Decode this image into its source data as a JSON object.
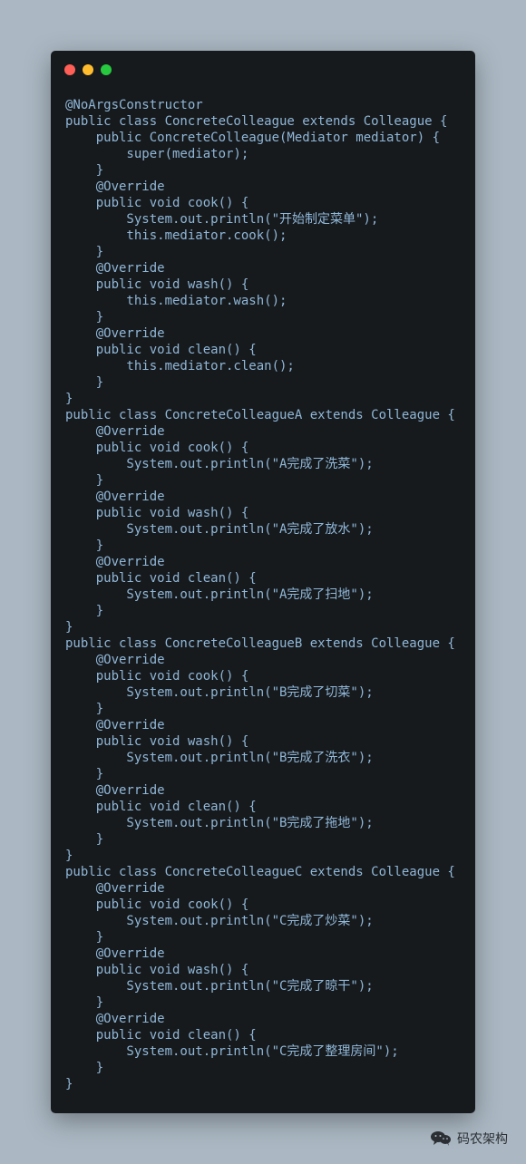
{
  "window": {
    "buttons": [
      {
        "name": "close",
        "color": "#ff5f56"
      },
      {
        "name": "minimize",
        "color": "#ffbd2e"
      },
      {
        "name": "maximize",
        "color": "#27c93f"
      }
    ]
  },
  "code": {
    "lines": [
      "@NoArgsConstructor",
      "public class ConcreteColleague extends Colleague {",
      "    public ConcreteColleague(Mediator mediator) {",
      "        super(mediator);",
      "    }",
      "    @Override",
      "    public void cook() {",
      "        System.out.println(\"开始制定菜单\");",
      "        this.mediator.cook();",
      "    }",
      "    @Override",
      "    public void wash() {",
      "        this.mediator.wash();",
      "    }",
      "    @Override",
      "    public void clean() {",
      "        this.mediator.clean();",
      "    }",
      "}",
      "public class ConcreteColleagueA extends Colleague {",
      "    @Override",
      "    public void cook() {",
      "        System.out.println(\"A完成了洗菜\");",
      "    }",
      "    @Override",
      "    public void wash() {",
      "        System.out.println(\"A完成了放水\");",
      "    }",
      "    @Override",
      "    public void clean() {",
      "        System.out.println(\"A完成了扫地\");",
      "    }",
      "}",
      "public class ConcreteColleagueB extends Colleague {",
      "    @Override",
      "    public void cook() {",
      "        System.out.println(\"B完成了切菜\");",
      "    }",
      "    @Override",
      "    public void wash() {",
      "        System.out.println(\"B完成了洗衣\");",
      "    }",
      "    @Override",
      "    public void clean() {",
      "        System.out.println(\"B完成了拖地\");",
      "    }",
      "}",
      "public class ConcreteColleagueC extends Colleague {",
      "    @Override",
      "    public void cook() {",
      "        System.out.println(\"C完成了炒菜\");",
      "    }",
      "    @Override",
      "    public void wash() {",
      "        System.out.println(\"C完成了晾干\");",
      "    }",
      "    @Override",
      "    public void clean() {",
      "        System.out.println(\"C完成了整理房间\");",
      "    }",
      "}"
    ]
  },
  "watermark": {
    "label": "码农架构",
    "icon": "wechat-icon"
  },
  "colors": {
    "background": "#abb8c3",
    "editor_background": "#171a1d",
    "code_text": "#8fb7d8"
  }
}
